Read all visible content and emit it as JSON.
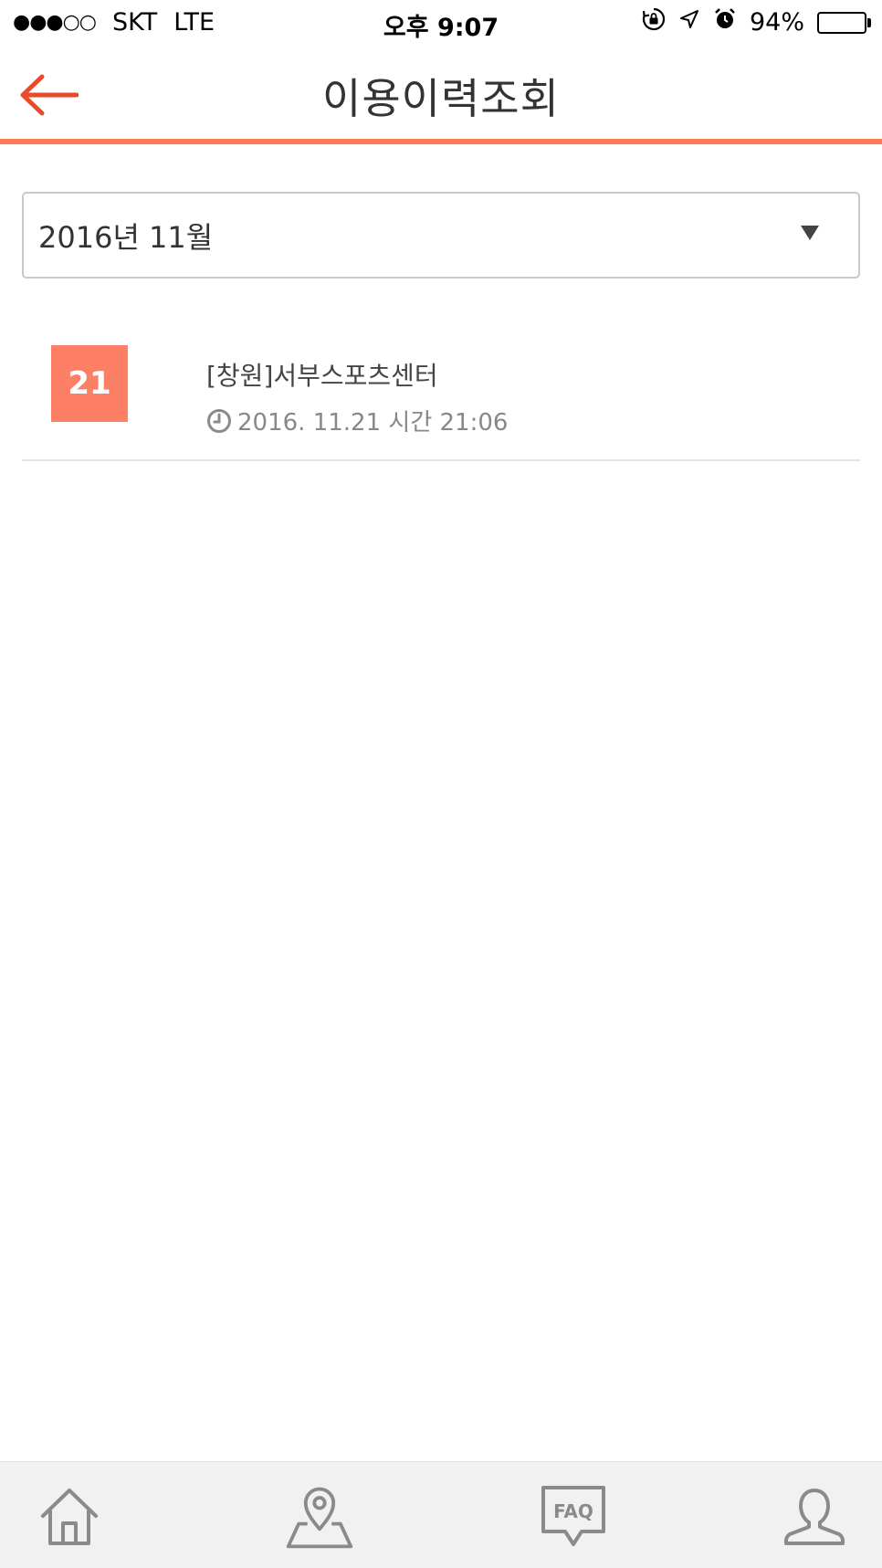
{
  "status_bar": {
    "signal": "●●●○○",
    "carrier": "SKT",
    "network": "LTE",
    "time": "오후 9:07",
    "battery_text": "94%",
    "battery_level": 0.94
  },
  "header": {
    "title": "이용이력조회"
  },
  "month_select": {
    "value": "2016년 11월"
  },
  "history": [
    {
      "day": "21",
      "facility": "[창원]서부스포츠센터",
      "datetime": "2016. 11.21 시간 21:06"
    }
  ],
  "colors": {
    "accent": "#ff7b56",
    "badge": "#fd8066",
    "nav_background": "#f1f1f1",
    "nav_icon": "#8a8a8a"
  },
  "bottom_nav": {
    "items": [
      {
        "icon": "home-icon"
      },
      {
        "icon": "map-pin-icon"
      },
      {
        "icon": "faq-icon",
        "label": "FAQ"
      },
      {
        "icon": "user-icon"
      }
    ]
  }
}
